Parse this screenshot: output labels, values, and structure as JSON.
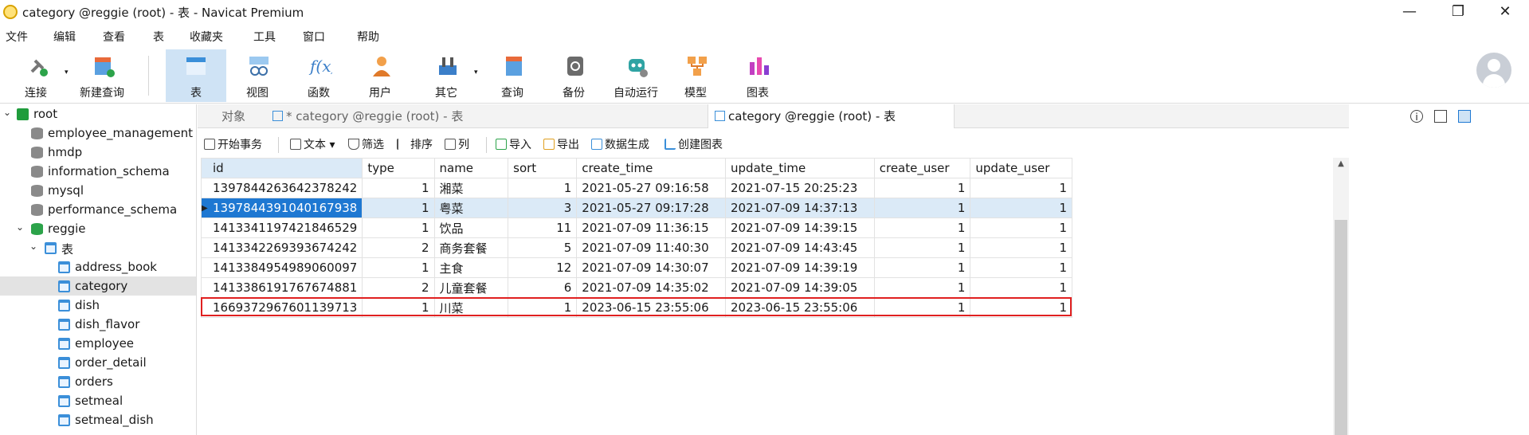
{
  "window": {
    "title": "category @reggie (root) - 表 - Navicat Premium"
  },
  "menu": [
    "文件",
    "编辑",
    "查看",
    "表",
    "收藏夹",
    "工具",
    "窗口",
    "帮助"
  ],
  "toolbar": [
    "连接",
    "新建查询",
    "表",
    "视图",
    "函数",
    "用户",
    "其它",
    "查询",
    "备份",
    "自动运行",
    "模型",
    "图表"
  ],
  "sidebar": {
    "items": [
      {
        "label": "root"
      },
      {
        "label": "employee_management"
      },
      {
        "label": "hmdp"
      },
      {
        "label": "information_schema"
      },
      {
        "label": "mysql"
      },
      {
        "label": "performance_schema"
      },
      {
        "label": "reggie"
      },
      {
        "label": "表"
      },
      {
        "label": "address_book"
      },
      {
        "label": "category"
      },
      {
        "label": "dish"
      },
      {
        "label": "dish_flavor"
      },
      {
        "label": "employee"
      },
      {
        "label": "order_detail"
      },
      {
        "label": "orders"
      },
      {
        "label": "setmeal"
      },
      {
        "label": "setmeal_dish"
      }
    ]
  },
  "tabs": [
    "对象",
    "* category @reggie (root) - 表",
    "category @reggie (root) - 表"
  ],
  "subtoolbar": [
    "开始事务",
    "文本",
    "筛选",
    "排序",
    "列",
    "导入",
    "导出",
    "数据生成",
    "创建图表"
  ],
  "grid": {
    "columns": [
      "id",
      "type",
      "name",
      "sort",
      "create_time",
      "update_time",
      "create_user",
      "update_user"
    ],
    "rows": [
      [
        "1397844263642378242",
        "1",
        "湘菜",
        "1",
        "2021-05-27 09:16:58",
        "2021-07-15 20:25:23",
        "1",
        "1"
      ],
      [
        "1397844391040167938",
        "1",
        "粤菜",
        "3",
        "2021-05-27 09:17:28",
        "2021-07-09 14:37:13",
        "1",
        "1"
      ],
      [
        "1413341197421846529",
        "1",
        "饮品",
        "11",
        "2021-07-09 11:36:15",
        "2021-07-09 14:39:15",
        "1",
        "1"
      ],
      [
        "1413342269393674242",
        "2",
        "商务套餐",
        "5",
        "2021-07-09 11:40:30",
        "2021-07-09 14:43:45",
        "1",
        "1"
      ],
      [
        "1413384954989060097",
        "1",
        "主食",
        "12",
        "2021-07-09 14:30:07",
        "2021-07-09 14:39:19",
        "1",
        "1"
      ],
      [
        "1413386191767674881",
        "2",
        "儿童套餐",
        "6",
        "2021-07-09 14:35:02",
        "2021-07-09 14:39:05",
        "1",
        "1"
      ],
      [
        "1669372967601139713",
        "1",
        "川菜",
        "1",
        "2023-06-15 23:55:06",
        "2023-06-15 23:55:06",
        "1",
        "1"
      ]
    ]
  },
  "colors": {
    "accent": "#1e78d2",
    "selected_row": "#dbeaf7",
    "highlight": "#e02020"
  }
}
